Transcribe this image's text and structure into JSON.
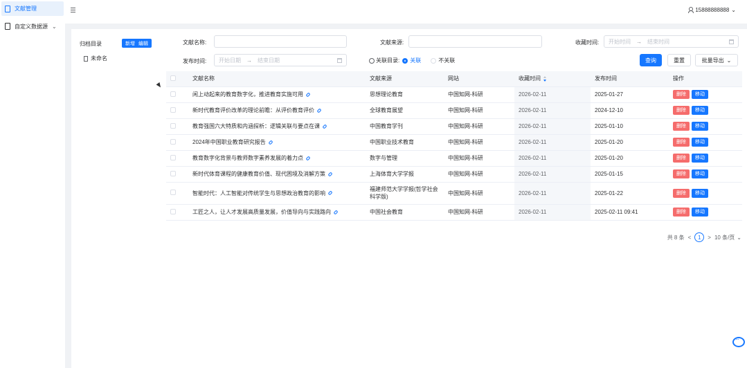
{
  "sidebar": {
    "active_item": "文献管理",
    "items": [
      {
        "label": "自定义数据源"
      }
    ]
  },
  "header": {
    "username": "15888888888"
  },
  "category": {
    "title": "归档目录",
    "add_label": "新增",
    "edit_label": "编辑",
    "nodes": [
      {
        "label": "未命名"
      }
    ]
  },
  "filters": {
    "name_label": "文献名称:",
    "name_value": "",
    "source_label": "文献来源:",
    "source_value": "",
    "collect_time_label": "收藏时间:",
    "collect_start_placeholder": "开始时间",
    "collect_end_placeholder": "结束时间",
    "publish_time_label": "发布时间:",
    "publish_start_placeholder": "开始日期",
    "publish_end_placeholder": "结束日期",
    "range_separator": "→",
    "associated_label": "关联目录:",
    "option_associated": "关联",
    "option_unassociated": "不关联"
  },
  "actions": {
    "search": "查询",
    "reset": "重置",
    "batch_export": "批量导出"
  },
  "table": {
    "columns": [
      "文献名称",
      "文献来源",
      "网站",
      "收藏时间",
      "发布时间",
      "操作"
    ],
    "delete_label": "删除",
    "move_label": "移动",
    "rows": [
      {
        "title": "闲上动起来的教育数字化，推进教育实施可用",
        "source": "思想理论教育",
        "site": "中国知网-科研",
        "collected": "2026-02-11",
        "published": "2025-01-27"
      },
      {
        "title": "新时代教育评价改革的理论前瞻：从评价教育评价",
        "source": "全球教育展望",
        "site": "中国知网-科研",
        "collected": "2026-02-11",
        "published": "2024-12-10"
      },
      {
        "title": "教育强国六大特质和内涵探析：逻辑关联与要点在课",
        "source": "中国教育学刊",
        "site": "中国知网-科研",
        "collected": "2026-02-11",
        "published": "2025-01-10"
      },
      {
        "title": "2024年中国职业教育研究报告",
        "source": "中国职业技术教育",
        "site": "中国知网-科研",
        "collected": "2026-02-11",
        "published": "2025-01-20"
      },
      {
        "title": "教育数字化背景与教师数字素养发展的着力点",
        "source": "数字与管理",
        "site": "中国知网-科研",
        "collected": "2026-02-11",
        "published": "2025-01-20"
      },
      {
        "title": "新时代体育课程的健康教育价值、现代困境及消解方策",
        "source": "上海体育大学学报",
        "site": "中国知网-科研",
        "collected": "2026-02-11",
        "published": "2025-01-15"
      },
      {
        "title": "智能时代：人工智能对传统学生与思想政治教育的影响",
        "source": "福建师范大学学报(哲学社会科学版)",
        "site": "中国知网-科研",
        "collected": "2026-02-11",
        "published": "2025-01-22"
      },
      {
        "title": "工匠之人，让人才发展高质量发展，价值导向与实践路向",
        "source": "中国社会教育",
        "site": "中国知网-科研",
        "collected": "2026-02-11",
        "published": "2025-02-11 09:41"
      }
    ]
  },
  "pagination": {
    "total": "共 8 条",
    "prev": "<",
    "current": "1",
    "next": ">",
    "page_size": "10 条/页"
  },
  "colors": {
    "primary": "#1677ff",
    "danger": "#f56c6c"
  },
  "icons": [
    "document-icon",
    "folder-icon",
    "hamburger-icon",
    "user-icon",
    "chevron-down-icon",
    "calendar-icon",
    "info-icon",
    "link-icon",
    "sort-icon",
    "chat-icon"
  ]
}
